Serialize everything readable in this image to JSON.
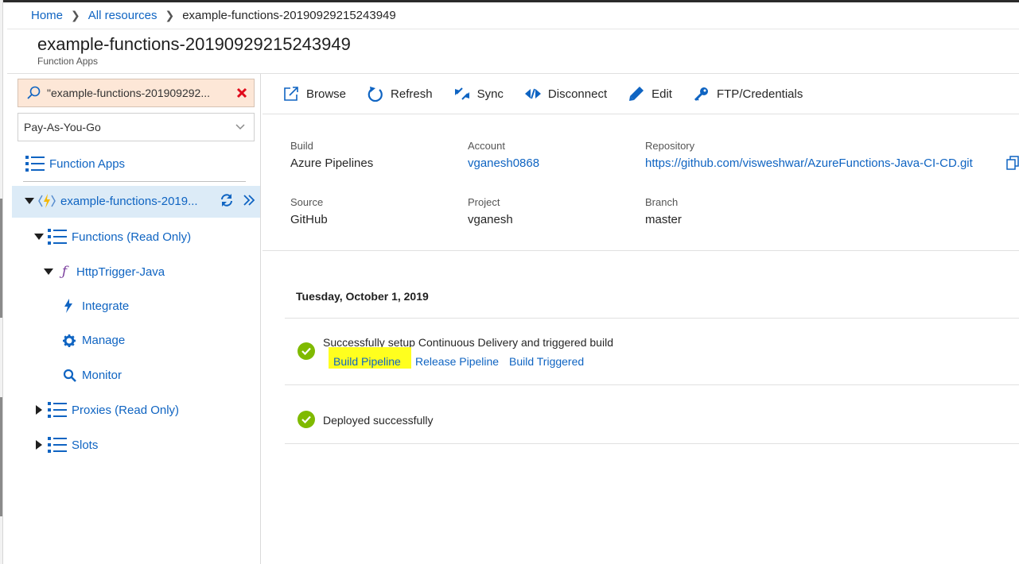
{
  "breadcrumb": {
    "home": "Home",
    "all_resources": "All resources",
    "current": "example-functions-20190929215243949"
  },
  "header": {
    "title": "example-functions-20190929215243949",
    "subtitle": "Function Apps"
  },
  "sidebar": {
    "search_value": "\"example-functions-201909292...",
    "subscription": "Pay-As-You-Go",
    "function_apps_label": "Function Apps",
    "app_item_label": "example-functions-2019...",
    "functions_label": "Functions (Read Only)",
    "function_name": "HttpTrigger-Java",
    "integrate_label": "Integrate",
    "manage_label": "Manage",
    "monitor_label": "Monitor",
    "proxies_label": "Proxies (Read Only)",
    "slots_label": "Slots"
  },
  "toolbar": {
    "browse": "Browse",
    "refresh": "Refresh",
    "sync": "Sync",
    "disconnect": "Disconnect",
    "edit": "Edit",
    "ftp": "FTP/Credentials"
  },
  "deployment_info": {
    "build_label": "Build",
    "build_value": "Azure Pipelines",
    "account_label": "Account",
    "account_value": "vganesh0868",
    "repository_label": "Repository",
    "repository_value": "https://github.com/visweshwar/AzureFunctions-Java-CI-CD.git",
    "source_label": "Source",
    "source_value": "GitHub",
    "project_label": "Project",
    "project_value": "vganesh",
    "branch_label": "Branch",
    "branch_value": "master"
  },
  "log": {
    "date": "Tuesday, October 1, 2019",
    "event1_text": "Successfully setup Continuous Delivery and triggered build",
    "event1_links": [
      "Build Pipeline",
      "Release Pipeline",
      "Build Triggered"
    ],
    "event2_text": "Deployed successfully"
  },
  "colors": {
    "link": "#0f64c2",
    "success": "#7fba00",
    "selection": "#dcebf7",
    "highlight": "#ffff1e",
    "search_bg": "#fde7d7"
  }
}
